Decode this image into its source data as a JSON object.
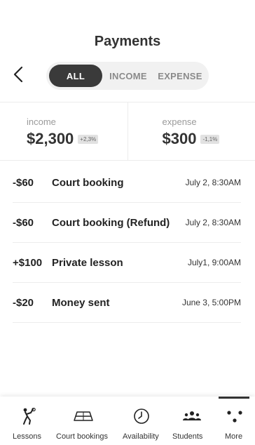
{
  "header": {
    "title": "Payments",
    "back_icon": "back-arrow-icon"
  },
  "filter_tabs": [
    {
      "label": "ALL",
      "active": true
    },
    {
      "label": "INCOME",
      "active": false
    },
    {
      "label": "EXPENSE",
      "active": false
    }
  ],
  "summary": {
    "income": {
      "label": "income",
      "amount": "$2,300",
      "change": "+2,3%"
    },
    "expense": {
      "label": "expense",
      "amount": "$300",
      "change": "-1,1%"
    }
  },
  "transactions": [
    {
      "amount": "-$60",
      "description": "Court booking",
      "date": "July 2, 8:30AM"
    },
    {
      "amount": "-$60",
      "description": "Court booking (Refund)",
      "date": "July 2, 8:30AM"
    },
    {
      "amount": "+$100",
      "description": "Private lesson",
      "date": "July1, 9:00AM"
    },
    {
      "amount": "-$20",
      "description": "Money sent",
      "date": "June 3, 5:00PM"
    }
  ],
  "tabbar": [
    {
      "label": "Lessons",
      "icon": "tennis-player-icon",
      "active": false
    },
    {
      "label": "Court bookings",
      "icon": "court-icon",
      "active": false
    },
    {
      "label": "Availability",
      "icon": "clock-icon",
      "active": false
    },
    {
      "label": "Students",
      "icon": "students-icon",
      "active": false
    },
    {
      "label": "More",
      "icon": "more-dots-icon",
      "active": true
    }
  ],
  "colors": {
    "active_tab_bg": "#3a3a3a",
    "segment_bg": "#f1f1f1",
    "divider": "#ececec",
    "muted_text": "#9a9a9a"
  }
}
